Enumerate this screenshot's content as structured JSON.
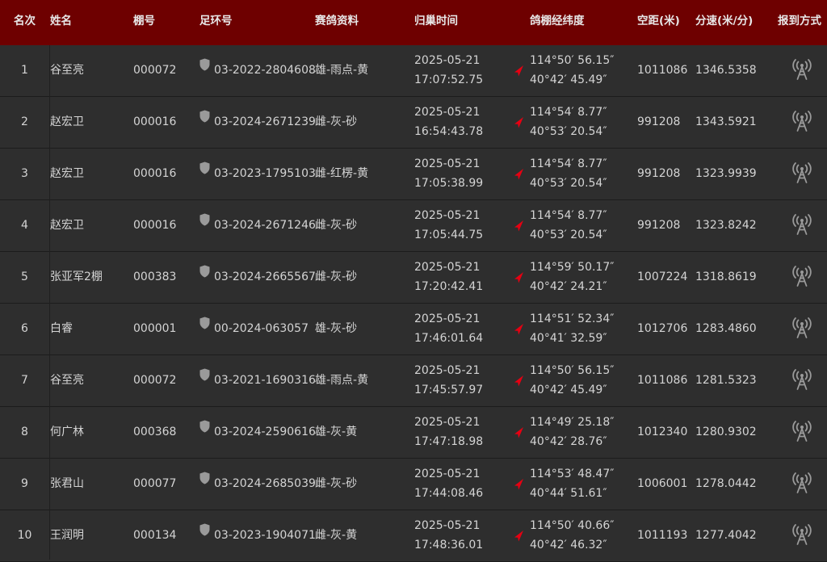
{
  "header": {
    "rank": "名次",
    "name": "姓名",
    "loft": "棚号",
    "ring": "足环号",
    "info": "赛鸽资料",
    "arrival": "归巢时间",
    "coords": "鸽棚经纬度",
    "distance": "空距(米)",
    "speed": "分速(米/分)",
    "report": "报到方式"
  },
  "colors": {
    "header_bg": "#6e0000",
    "row_bg": "#2e2e2e",
    "text": "#d4d4d4",
    "arrow": "#e60012",
    "icon_gray": "#9a9a9a"
  },
  "icons": {
    "ring_shield": "shield-icon",
    "location_arrow": "location-arrow-icon",
    "report_method": "signal-tower-icon"
  },
  "rows": [
    {
      "rank": "1",
      "name": "谷至亮",
      "loft": "000072",
      "ring": "03-2022-2804608",
      "info": "雄-雨点-黄",
      "date": "2025-05-21",
      "time": "17:07:52.75",
      "lon": "114°50′ 56.15″",
      "lat": "40°42′ 45.49″",
      "distance": "1011086",
      "speed": "1346.5358"
    },
    {
      "rank": "2",
      "name": "赵宏卫",
      "loft": "000016",
      "ring": "03-2024-2671239",
      "info": "雌-灰-砂",
      "date": "2025-05-21",
      "time": "16:54:43.78",
      "lon": "114°54′ 8.77″",
      "lat": "40°53′ 20.54″",
      "distance": "991208",
      "speed": "1343.5921"
    },
    {
      "rank": "3",
      "name": "赵宏卫",
      "loft": "000016",
      "ring": "03-2023-1795103",
      "info": "雌-红楞-黄",
      "date": "2025-05-21",
      "time": "17:05:38.99",
      "lon": "114°54′ 8.77″",
      "lat": "40°53′ 20.54″",
      "distance": "991208",
      "speed": "1323.9939"
    },
    {
      "rank": "4",
      "name": "赵宏卫",
      "loft": "000016",
      "ring": "03-2024-2671246",
      "info": "雌-灰-砂",
      "date": "2025-05-21",
      "time": "17:05:44.75",
      "lon": "114°54′ 8.77″",
      "lat": "40°53′ 20.54″",
      "distance": "991208",
      "speed": "1323.8242"
    },
    {
      "rank": "5",
      "name": "张亚军2棚",
      "loft": "000383",
      "ring": "03-2024-2665567",
      "info": "雌-灰-砂",
      "date": "2025-05-21",
      "time": "17:20:42.41",
      "lon": "114°59′ 50.17″",
      "lat": "40°42′ 24.21″",
      "distance": "1007224",
      "speed": "1318.8619"
    },
    {
      "rank": "6",
      "name": "白睿",
      "loft": "000001",
      "ring": "00-2024-063057",
      "info": "雄-灰-砂",
      "date": "2025-05-21",
      "time": "17:46:01.64",
      "lon": "114°51′ 52.34″",
      "lat": "40°41′ 32.59″",
      "distance": "1012706",
      "speed": "1283.4860"
    },
    {
      "rank": "7",
      "name": "谷至亮",
      "loft": "000072",
      "ring": "03-2021-1690316",
      "info": "雄-雨点-黄",
      "date": "2025-05-21",
      "time": "17:45:57.97",
      "lon": "114°50′ 56.15″",
      "lat": "40°42′ 45.49″",
      "distance": "1011086",
      "speed": "1281.5323"
    },
    {
      "rank": "8",
      "name": "何广林",
      "loft": "000368",
      "ring": "03-2024-2590616",
      "info": "雄-灰-黄",
      "date": "2025-05-21",
      "time": "17:47:18.98",
      "lon": "114°49′ 25.18″",
      "lat": "40°42′ 28.76″",
      "distance": "1012340",
      "speed": "1280.9302"
    },
    {
      "rank": "9",
      "name": "张君山",
      "loft": "000077",
      "ring": "03-2024-2685039",
      "info": "雌-灰-砂",
      "date": "2025-05-21",
      "time": "17:44:08.46",
      "lon": "114°53′ 48.47″",
      "lat": "40°44′ 51.61″",
      "distance": "1006001",
      "speed": "1278.0442"
    },
    {
      "rank": "10",
      "name": "王润明",
      "loft": "000134",
      "ring": "03-2023-1904071",
      "info": "雌-灰-黄",
      "date": "2025-05-21",
      "time": "17:48:36.01",
      "lon": "114°50′ 40.66″",
      "lat": "40°42′ 46.32″",
      "distance": "1011193",
      "speed": "1277.4042"
    }
  ]
}
